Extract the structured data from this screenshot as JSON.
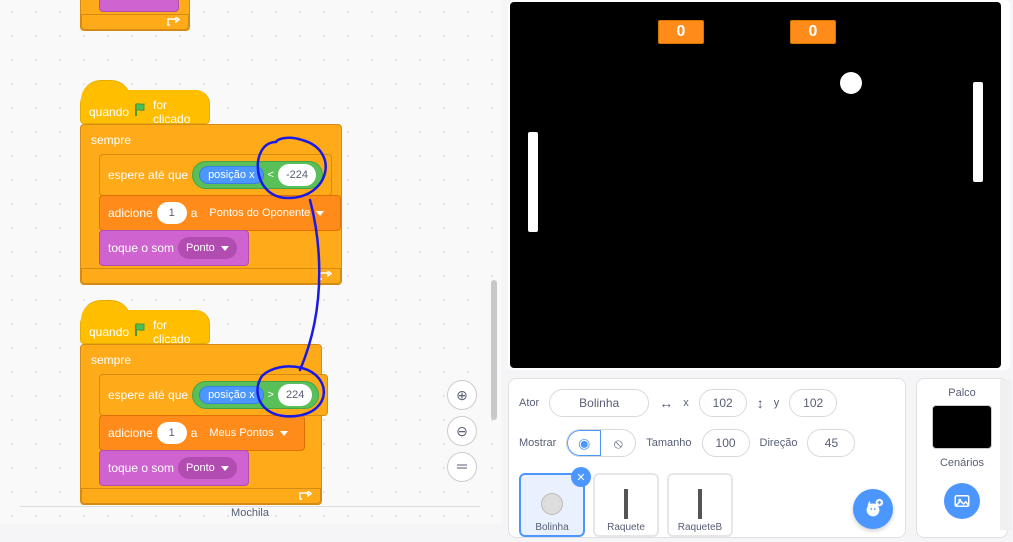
{
  "colors": {
    "control": "#ffab19",
    "event": "#ffbf00",
    "data": "#ff8c1a",
    "sound": "#cf63cf",
    "operator": "#59c059",
    "motion": "#4c97ff",
    "accent": "#4c97ff"
  },
  "code": {
    "stack0": {
      "foot_icon": "loop-arrow"
    },
    "stack1": {
      "hat_prefix": "quando",
      "hat_suffix": "for clicado",
      "forever_label": "sempre",
      "wait_until_label": "espere até que",
      "posicao_x": "posição x",
      "op_symbol": "<",
      "op_value": "-224",
      "add_label_1": "adicione",
      "add_value": "1",
      "add_label_2": "a",
      "add_var": "Pontos do Oponente",
      "sound_label": "toque o som",
      "sound_value": "Ponto"
    },
    "stack2": {
      "hat_prefix": "quando",
      "hat_suffix": "for clicado",
      "forever_label": "sempre",
      "wait_until_label": "espere até que",
      "posicao_x": "posição x",
      "op_symbol": ">",
      "op_value": "224",
      "add_label_1": "adicione",
      "add_value": "1",
      "add_label_2": "a",
      "add_var": "Meus Pontos",
      "sound_label": "toque o som",
      "sound_value": "Ponto"
    },
    "backpack": "Mochila"
  },
  "stage": {
    "score1": "0",
    "score2": "0"
  },
  "sprite_info": {
    "ator_label": "Ator",
    "name": "Bolinha",
    "x_label": "x",
    "x_value": "102",
    "y_label": "y",
    "y_value": "102",
    "mostrar_label": "Mostrar",
    "tamanho_label": "Tamanho",
    "tamanho_value": "100",
    "direcao_label": "Direção",
    "direcao_value": "45"
  },
  "sprites": {
    "items": [
      {
        "name": "Bolinha",
        "selected": true,
        "delete": true
      },
      {
        "name": "Raquete",
        "selected": false,
        "delete": false
      },
      {
        "name": "RaqueteB",
        "selected": false,
        "delete": false
      }
    ]
  },
  "palco": {
    "title": "Palco",
    "cenarios": "Cenários"
  },
  "glyphs": {
    "eye": "◉",
    "eye_off": "⦸",
    "swap_h": "↔",
    "swap_v": "↕",
    "plus": "＋",
    "equals": "＝",
    "zoom_in": "⊕",
    "zoom_out": "⊖",
    "cat": "🐱",
    "image": "🖼",
    "trash": "✕"
  }
}
